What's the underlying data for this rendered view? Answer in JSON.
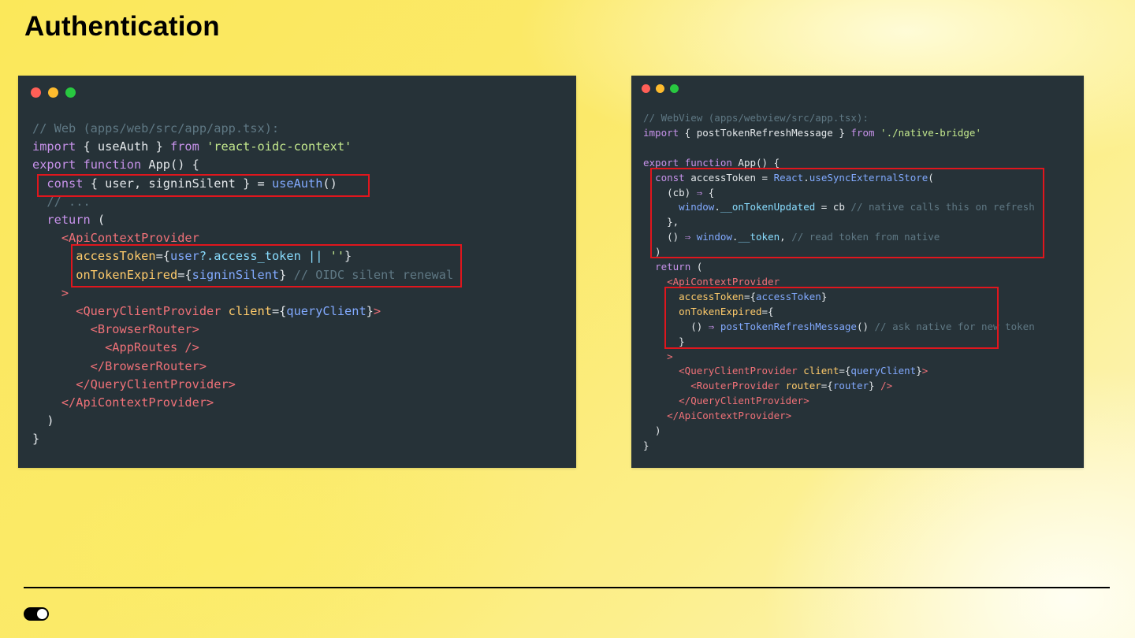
{
  "slide": {
    "title": "Authentication"
  },
  "left_window": {
    "code_lines": [
      [
        {
          "t": "// Web (apps/web/src/app/app.tsx):",
          "c": "comment"
        }
      ],
      [
        {
          "t": "import",
          "c": "kw"
        },
        {
          "t": " { useAuth } ",
          "c": "plain"
        },
        {
          "t": "from",
          "c": "kw"
        },
        {
          "t": " ",
          "c": "plain"
        },
        {
          "t": "'react-oidc-context'",
          "c": "str"
        }
      ],
      [
        {
          "t": "export",
          "c": "kw"
        },
        {
          "t": " ",
          "c": "plain"
        },
        {
          "t": "function",
          "c": "kw"
        },
        {
          "t": " App() {",
          "c": "plain"
        }
      ],
      [
        {
          "t": "  ",
          "c": "plain"
        },
        {
          "t": "const",
          "c": "kw"
        },
        {
          "t": " { user, signinSilent } = ",
          "c": "plain"
        },
        {
          "t": "useAuth",
          "c": "fn"
        },
        {
          "t": "()",
          "c": "plain"
        }
      ],
      [
        {
          "t": "  // ...",
          "c": "comment"
        }
      ],
      [
        {
          "t": "  ",
          "c": "plain"
        },
        {
          "t": "return",
          "c": "kw"
        },
        {
          "t": " (",
          "c": "plain"
        }
      ],
      [
        {
          "t": "    <ApiContextProvider",
          "c": "tag"
        }
      ],
      [
        {
          "t": "      ",
          "c": "plain"
        },
        {
          "t": "accessToken",
          "c": "attr"
        },
        {
          "t": "={",
          "c": "plain"
        },
        {
          "t": "user",
          "c": "fn"
        },
        {
          "t": "?.",
          "c": "op"
        },
        {
          "t": "access_token",
          "c": "prop"
        },
        {
          "t": " || ",
          "c": "op"
        },
        {
          "t": "''",
          "c": "str"
        },
        {
          "t": "}",
          "c": "plain"
        }
      ],
      [
        {
          "t": "      ",
          "c": "plain"
        },
        {
          "t": "onTokenExpired",
          "c": "attr"
        },
        {
          "t": "={",
          "c": "plain"
        },
        {
          "t": "signinSilent",
          "c": "fn"
        },
        {
          "t": "} ",
          "c": "plain"
        },
        {
          "t": "// OIDC silent renewal",
          "c": "comment"
        }
      ],
      [
        {
          "t": "    >",
          "c": "tag"
        }
      ],
      [
        {
          "t": "      <QueryClientProvider",
          "c": "tag"
        },
        {
          "t": " ",
          "c": "plain"
        },
        {
          "t": "client",
          "c": "attr"
        },
        {
          "t": "={",
          "c": "plain"
        },
        {
          "t": "queryClient",
          "c": "fn"
        },
        {
          "t": "}",
          "c": "plain"
        },
        {
          "t": ">",
          "c": "tag"
        }
      ],
      [
        {
          "t": "        <BrowserRouter>",
          "c": "tag"
        }
      ],
      [
        {
          "t": "          <AppRoutes />",
          "c": "tag"
        }
      ],
      [
        {
          "t": "        </BrowserRouter>",
          "c": "tag"
        }
      ],
      [
        {
          "t": "      </QueryClientProvider>",
          "c": "tag"
        }
      ],
      [
        {
          "t": "    </ApiContextProvider>",
          "c": "tag"
        }
      ],
      [
        {
          "t": "  )",
          "c": "plain"
        }
      ],
      [
        {
          "t": "}",
          "c": "plain"
        }
      ]
    ]
  },
  "right_window": {
    "code_lines": [
      [
        {
          "t": "// WebView (apps/webview/src/app.tsx):",
          "c": "comment"
        }
      ],
      [
        {
          "t": "import",
          "c": "kw"
        },
        {
          "t": " { postTokenRefreshMessage } ",
          "c": "plain"
        },
        {
          "t": "from",
          "c": "kw"
        },
        {
          "t": " ",
          "c": "plain"
        },
        {
          "t": "'./native-bridge'",
          "c": "str"
        }
      ],
      [
        {
          "t": "",
          "c": "plain"
        }
      ],
      [
        {
          "t": "export",
          "c": "kw"
        },
        {
          "t": " ",
          "c": "plain"
        },
        {
          "t": "function",
          "c": "kw"
        },
        {
          "t": " App() {",
          "c": "plain"
        }
      ],
      [
        {
          "t": "  ",
          "c": "plain"
        },
        {
          "t": "const",
          "c": "kw"
        },
        {
          "t": " accessToken = ",
          "c": "plain"
        },
        {
          "t": "React",
          "c": "fn"
        },
        {
          "t": ".",
          "c": "plain"
        },
        {
          "t": "useSyncExternalStore",
          "c": "fn"
        },
        {
          "t": "(",
          "c": "plain"
        }
      ],
      [
        {
          "t": "    (cb) ",
          "c": "plain"
        },
        {
          "t": "⇒",
          "c": "kw"
        },
        {
          "t": " {",
          "c": "plain"
        }
      ],
      [
        {
          "t": "      ",
          "c": "plain"
        },
        {
          "t": "window",
          "c": "fn"
        },
        {
          "t": ".",
          "c": "plain"
        },
        {
          "t": "__onTokenUpdated",
          "c": "prop"
        },
        {
          "t": " = cb ",
          "c": "plain"
        },
        {
          "t": "// native calls this on refresh",
          "c": "comment"
        }
      ],
      [
        {
          "t": "    },",
          "c": "plain"
        }
      ],
      [
        {
          "t": "    () ",
          "c": "plain"
        },
        {
          "t": "⇒",
          "c": "kw"
        },
        {
          "t": " ",
          "c": "plain"
        },
        {
          "t": "window",
          "c": "fn"
        },
        {
          "t": ".",
          "c": "plain"
        },
        {
          "t": "__token",
          "c": "prop"
        },
        {
          "t": ", ",
          "c": "plain"
        },
        {
          "t": "// read token from native",
          "c": "comment"
        }
      ],
      [
        {
          "t": "  )",
          "c": "plain"
        }
      ],
      [
        {
          "t": "  ",
          "c": "plain"
        },
        {
          "t": "return",
          "c": "kw"
        },
        {
          "t": " (",
          "c": "plain"
        }
      ],
      [
        {
          "t": "    <ApiContextProvider",
          "c": "tag"
        }
      ],
      [
        {
          "t": "      ",
          "c": "plain"
        },
        {
          "t": "accessToken",
          "c": "attr"
        },
        {
          "t": "={",
          "c": "plain"
        },
        {
          "t": "accessToken",
          "c": "fn"
        },
        {
          "t": "}",
          "c": "plain"
        }
      ],
      [
        {
          "t": "      ",
          "c": "plain"
        },
        {
          "t": "onTokenExpired",
          "c": "attr"
        },
        {
          "t": "={",
          "c": "plain"
        }
      ],
      [
        {
          "t": "        () ",
          "c": "plain"
        },
        {
          "t": "⇒",
          "c": "kw"
        },
        {
          "t": " ",
          "c": "plain"
        },
        {
          "t": "postTokenRefreshMessage",
          "c": "fn"
        },
        {
          "t": "() ",
          "c": "plain"
        },
        {
          "t": "// ask native for new token",
          "c": "comment"
        }
      ],
      [
        {
          "t": "      }",
          "c": "plain"
        }
      ],
      [
        {
          "t": "    >",
          "c": "tag"
        }
      ],
      [
        {
          "t": "      <QueryClientProvider",
          "c": "tag"
        },
        {
          "t": " ",
          "c": "plain"
        },
        {
          "t": "client",
          "c": "attr"
        },
        {
          "t": "={",
          "c": "plain"
        },
        {
          "t": "queryClient",
          "c": "fn"
        },
        {
          "t": "}",
          "c": "plain"
        },
        {
          "t": ">",
          "c": "tag"
        }
      ],
      [
        {
          "t": "        <RouterProvider",
          "c": "tag"
        },
        {
          "t": " ",
          "c": "plain"
        },
        {
          "t": "router",
          "c": "attr"
        },
        {
          "t": "={",
          "c": "plain"
        },
        {
          "t": "router",
          "c": "fn"
        },
        {
          "t": "} ",
          "c": "plain"
        },
        {
          "t": "/>",
          "c": "tag"
        }
      ],
      [
        {
          "t": "      </QueryClientProvider>",
          "c": "tag"
        }
      ],
      [
        {
          "t": "    </ApiContextProvider>",
          "c": "tag"
        }
      ],
      [
        {
          "t": "  )",
          "c": "plain"
        }
      ],
      [
        {
          "t": "}",
          "c": "plain"
        }
      ]
    ]
  },
  "colors": {
    "code_background": "#263238",
    "highlight_border": "#e0161d",
    "window_dot_red": "#ff5f57",
    "window_dot_yellow": "#febc2e",
    "window_dot_green": "#28c840"
  },
  "icons": {
    "footer": "toggle-switch-icon"
  }
}
